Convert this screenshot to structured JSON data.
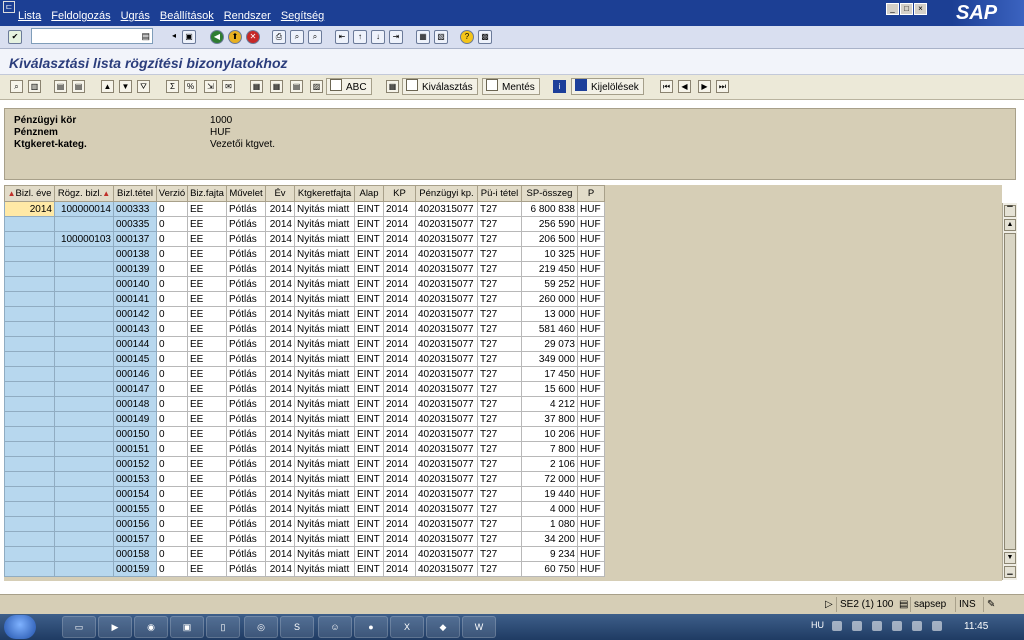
{
  "menu": {
    "items": [
      "Lista",
      "Feldolgozás",
      "Ugrás",
      "Beállítások",
      "Rendszer",
      "Segítség"
    ]
  },
  "sap_logo": "SAP",
  "title": "Kiválasztási lista rögzítési bizonylatokhoz",
  "app_toolbar": {
    "abc_label": "ABC",
    "select_label": "Kiválasztás",
    "save_label": "Mentés",
    "selections_label": "Kijelölések"
  },
  "header_info": {
    "rows": [
      {
        "label": "Pénzügyi kör",
        "value": "1000"
      },
      {
        "label": "Pénznem",
        "value": "HUF"
      },
      {
        "label": "Ktgkeret-kateg.",
        "value": "Vezetői ktgvet."
      }
    ]
  },
  "table": {
    "columns": [
      "Bizl. éve",
      "Rögz. bizl.",
      "Bizl.tétel",
      "Verzió",
      "Biz.fajta",
      "Művelet",
      "Év",
      "Ktgkeretfajta",
      "Alap",
      "KP",
      "Pénzügyi kp.",
      "Pü-i tétel",
      "SP-összeg",
      "P"
    ],
    "year": "2014",
    "docs": [
      "100000014",
      "100000103"
    ],
    "constants": {
      "verzio": "0",
      "bizfajta": "EE",
      "muvelet": "Pótlás",
      "ev": "2014",
      "ktgkeretfajta": "Nyitás miatt",
      "alap": "EINT",
      "kp": "2014",
      "penzugyi_kp": "4020315077",
      "pui_tetel": "T27",
      "p": "HUF"
    },
    "rows": [
      {
        "item": "000333",
        "amount": "6 800 838"
      },
      {
        "item": "000335",
        "amount": "256 590"
      },
      {
        "item": "000137",
        "amount": "206 500"
      },
      {
        "item": "000138",
        "amount": "10 325"
      },
      {
        "item": "000139",
        "amount": "219 450"
      },
      {
        "item": "000140",
        "amount": "59 252"
      },
      {
        "item": "000141",
        "amount": "260 000"
      },
      {
        "item": "000142",
        "amount": "13 000"
      },
      {
        "item": "000143",
        "amount": "581 460"
      },
      {
        "item": "000144",
        "amount": "29 073"
      },
      {
        "item": "000145",
        "amount": "349 000"
      },
      {
        "item": "000146",
        "amount": "17 450"
      },
      {
        "item": "000147",
        "amount": "15 600"
      },
      {
        "item": "000148",
        "amount": "4 212"
      },
      {
        "item": "000149",
        "amount": "37 800"
      },
      {
        "item": "000150",
        "amount": "10 206"
      },
      {
        "item": "000151",
        "amount": "7 800"
      },
      {
        "item": "000152",
        "amount": "2 106"
      },
      {
        "item": "000153",
        "amount": "72 000"
      },
      {
        "item": "000154",
        "amount": "19 440"
      },
      {
        "item": "000155",
        "amount": "4 000"
      },
      {
        "item": "000156",
        "amount": "1 080"
      },
      {
        "item": "000157",
        "amount": "34 200"
      },
      {
        "item": "000158",
        "amount": "9 234"
      },
      {
        "item": "000159",
        "amount": "60 750"
      }
    ]
  },
  "status": {
    "session": "SE2 (1) 100",
    "user": "sapsep",
    "mode": "INS"
  },
  "taskbar": {
    "lang": "HU",
    "time": "11:45"
  }
}
